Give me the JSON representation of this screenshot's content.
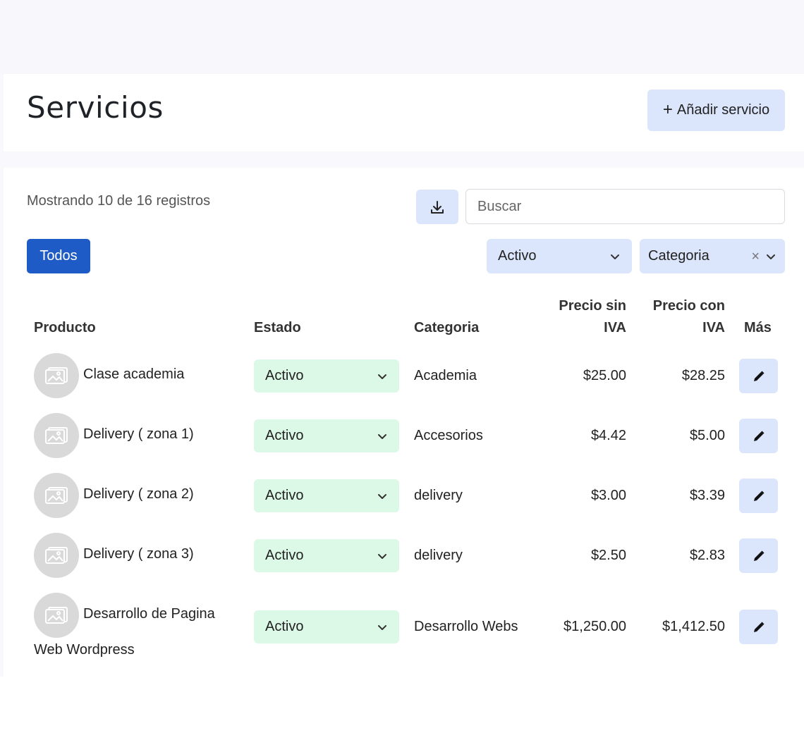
{
  "header": {
    "title": "Servicios",
    "add_button_label": "Añadir servicio"
  },
  "toolbar": {
    "records_text": "Mostrando 10 de 16 registros",
    "search_placeholder": "Buscar",
    "todos_label": "Todos",
    "status_filter_value": "Activo",
    "category_filter_value": "Categoria"
  },
  "table": {
    "headers": {
      "producto": "Producto",
      "estado": "Estado",
      "categoria": "Categoria",
      "precio_sin_line1": "Precio sin",
      "precio_sin_line2": "IVA",
      "precio_con_line1": "Precio con",
      "precio_con_line2": "IVA",
      "mas": "Más"
    },
    "rows": [
      {
        "producto": "Clase academia",
        "estado": "Activo",
        "categoria": "Academia",
        "precio_sin": "$25.00",
        "precio_con": "$28.25"
      },
      {
        "producto": "Delivery ( zona 1)",
        "estado": "Activo",
        "categoria": "Accesorios",
        "precio_sin": "$4.42",
        "precio_con": "$5.00"
      },
      {
        "producto": "Delivery ( zona 2)",
        "estado": "Activo",
        "categoria": "delivery",
        "precio_sin": "$3.00",
        "precio_con": "$3.39"
      },
      {
        "producto": "Delivery ( zona 3)",
        "estado": "Activo",
        "categoria": "delivery",
        "precio_sin": "$2.50",
        "precio_con": "$2.83"
      },
      {
        "producto_line1": "Desarrollo de Pagina",
        "producto_line2": "Web Wordpress",
        "estado": "Activo",
        "categoria": "Desarrollo Webs",
        "precio_sin": "$1,250.00",
        "precio_con": "$1,412.50"
      }
    ]
  },
  "icons": {
    "add": "plus-icon",
    "download": "download-icon",
    "dropdown": "chevron-down-icon",
    "clear": "close-icon",
    "thumbnail": "image-placeholder-icon",
    "edit": "pencil-icon"
  },
  "colors": {
    "primary": "#1e5bc6",
    "soft_blue": "#dbe5fb",
    "soft_green": "#dcf8e6",
    "thumb_gray": "#d9d9d9"
  }
}
